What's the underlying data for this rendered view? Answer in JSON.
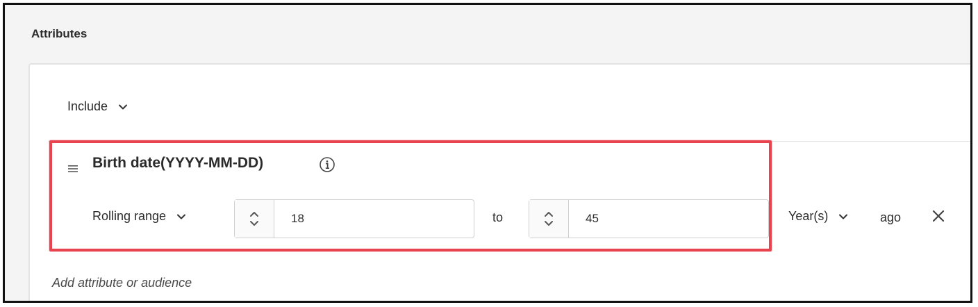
{
  "section": {
    "title": "Attributes"
  },
  "include": {
    "label": "Include",
    "icon": "chevron-down-icon"
  },
  "rule": {
    "attribute_name": "Birth date(YYYY-MM-DD)",
    "range_type": "Rolling range",
    "from_value": "18",
    "to_label": "to",
    "to_value": "45",
    "unit": "Year(s)",
    "suffix": "ago"
  },
  "add_link": "Add attribute or audience",
  "colors": {
    "highlight": "#e8444f",
    "frame": "#111111",
    "card_border": "#e3e3e3"
  }
}
